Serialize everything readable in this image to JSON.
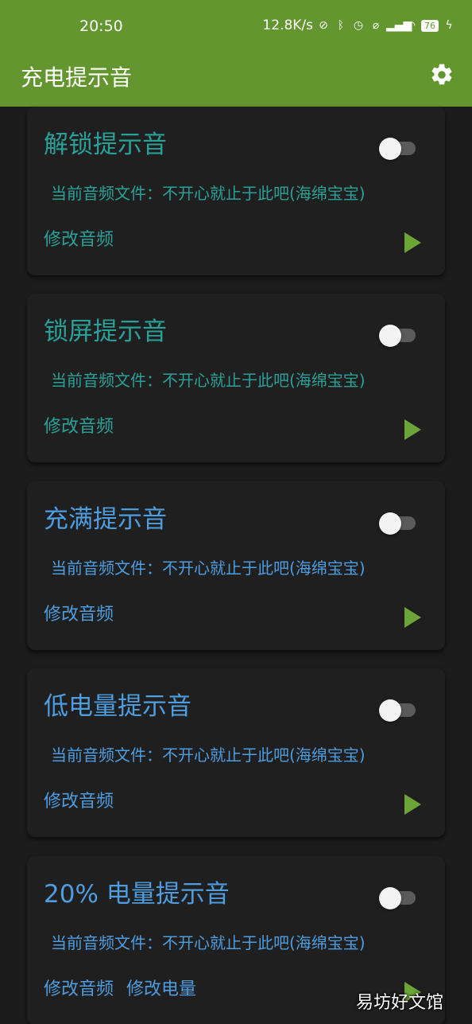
{
  "status_bar": {
    "time": "20:50",
    "net_speed": "12.8K/s",
    "battery": "76",
    "icons": [
      "no-disturb-icon",
      "bluetooth-icon",
      "alarm-icon",
      "mute-icon",
      "signal-icon",
      "wifi-icon",
      "battery-icon",
      "charging-icon"
    ]
  },
  "app_bar": {
    "title": "充电提示音",
    "settings_icon": "gear-icon"
  },
  "colors": {
    "accent": "#63962e",
    "background": "#1c1c1c",
    "card": "#1f1f1f",
    "teal_text": "#2aa198",
    "blue_text": "#4d9de0",
    "play": "#6da437"
  },
  "cards": [
    {
      "title": "解锁提示音",
      "file": "当前音频文件：不开心就止于此吧(海绵宝宝)",
      "action": "修改音频",
      "enabled": false,
      "color": "teal"
    },
    {
      "title": "锁屏提示音",
      "file": "当前音频文件：不开心就止于此吧(海绵宝宝)",
      "action": "修改音频",
      "enabled": false,
      "color": "teal"
    },
    {
      "title": "充满提示音",
      "file": "当前音频文件：不开心就止于此吧(海绵宝宝)",
      "action": "修改音频",
      "enabled": false,
      "color": "blue"
    },
    {
      "title": "低电量提示音",
      "file": "当前音频文件：不开心就止于此吧(海绵宝宝)",
      "action": "修改音频",
      "enabled": false,
      "color": "blue"
    },
    {
      "title": "20% 电量提示音",
      "file": "当前音频文件：不开心就止于此吧(海绵宝宝)",
      "action": "修改音频",
      "action2": "修改电量",
      "enabled": false,
      "color": "blue"
    }
  ],
  "watermark": "易坊好文馆"
}
